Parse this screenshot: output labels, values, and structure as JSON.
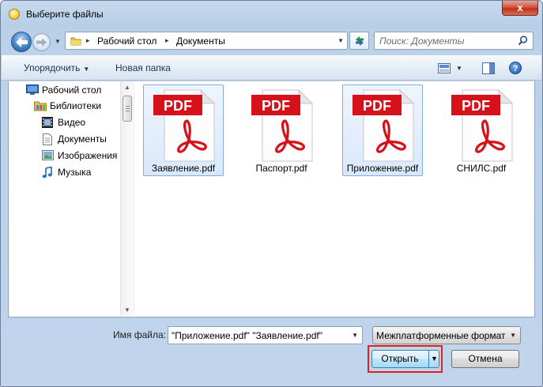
{
  "window": {
    "title": "Выберите файлы",
    "close_label": "x"
  },
  "nav": {
    "breadcrumbs": [
      "Рабочий стол",
      "Документы"
    ],
    "separator": "▸",
    "search_placeholder": "Поиск: Документы"
  },
  "toolbar": {
    "organize_label": "Упорядочить",
    "new_folder_label": "Новая папка",
    "help_label": "?"
  },
  "sidebar": {
    "items": [
      {
        "label": "Рабочий стол",
        "icon": "desktop-icon"
      },
      {
        "label": "Библиотеки",
        "icon": "libraries-icon"
      },
      {
        "label": "Видео",
        "icon": "video-icon"
      },
      {
        "label": "Документы",
        "icon": "documents-icon"
      },
      {
        "label": "Изображения",
        "icon": "pictures-icon"
      },
      {
        "label": "Музыка",
        "icon": "music-icon"
      }
    ]
  },
  "files": [
    {
      "name": "Заявление.pdf",
      "selected": true,
      "badge": "PDF"
    },
    {
      "name": "Паспорт.pdf",
      "selected": false,
      "badge": "PDF"
    },
    {
      "name": "Приложение.pdf",
      "selected": true,
      "badge": "PDF"
    },
    {
      "name": "СНИЛС.pdf",
      "selected": false,
      "badge": "PDF"
    }
  ],
  "bottom": {
    "filename_label": "Имя файла:",
    "filename_value": "\"Приложение.pdf\" \"Заявление.pdf\"",
    "filter_value": "Межплатформенные формат",
    "open_label": "Открыть",
    "cancel_label": "Отмена"
  },
  "colors": {
    "pdf_red": "#d7111a",
    "selection_border": "#84acdd",
    "highlight_red": "#e0201b"
  }
}
